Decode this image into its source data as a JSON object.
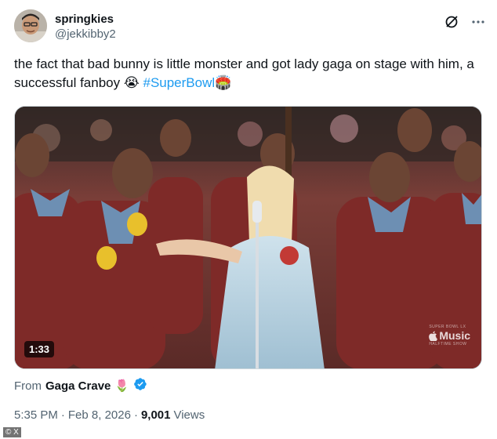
{
  "author": {
    "display_name": "springkies",
    "handle": "@jekkibby2"
  },
  "header_icons": [
    "grok-icon",
    "more-icon"
  ],
  "tweet": {
    "text": "the fact that bad bunny is little monster and got lady gaga on stage with him, a successful fanboy",
    "emoji": "😭",
    "hashtag": "#SuperBowl",
    "hashtag_emoji": "🏟️"
  },
  "media": {
    "duration": "1:33",
    "watermark_top": "SUPER BOWL LX",
    "watermark_brand": "Music",
    "watermark_sub": "HALFTIME SHOW"
  },
  "source": {
    "prefix": "From",
    "name": "Gaga Crave",
    "emoji": "🌷"
  },
  "meta": {
    "time": "5:35 PM",
    "separator": "·",
    "date": "Feb 8, 2026",
    "views_count": "9,001",
    "views_label": "Views"
  },
  "footer_mark": "© X",
  "colors": {
    "link": "#1d9bf0",
    "text": "#0f1419",
    "muted": "#536471",
    "verified": "#1d9bf0"
  }
}
